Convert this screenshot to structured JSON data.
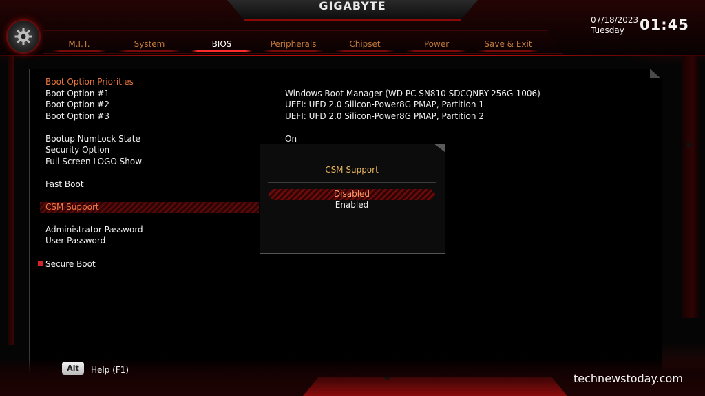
{
  "header": {
    "brand": "GIGABYTE",
    "date": "07/18/2023",
    "day": "Tuesday",
    "time": "01:45"
  },
  "tabs": [
    {
      "label": "M.I.T.",
      "active": false
    },
    {
      "label": "System",
      "active": false
    },
    {
      "label": "BIOS",
      "active": true
    },
    {
      "label": "Peripherals",
      "active": false
    },
    {
      "label": "Chipset",
      "active": false
    },
    {
      "label": "Power",
      "active": false
    },
    {
      "label": "Save & Exit",
      "active": false
    }
  ],
  "bios": {
    "section_heading": "Boot Option Priorities",
    "items": [
      {
        "label": "Boot Option #1",
        "value": "Windows Boot Manager (WD PC SN810 SDCQNRY-256G-1006)"
      },
      {
        "label": "Boot Option #2",
        "value": "UEFI: UFD 2.0 Silicon-Power8G PMAP, Partition 1"
      },
      {
        "label": "Boot Option #3",
        "value": "UEFI: UFD 2.0 Silicon-Power8G PMAP, Partition 2"
      },
      {
        "label": "Bootup NumLock State",
        "value": "On"
      },
      {
        "label": "Security Option",
        "value": ""
      },
      {
        "label": "Full Screen LOGO Show",
        "value": ""
      },
      {
        "label": "Fast Boot",
        "value": ""
      },
      {
        "label": "CSM Support",
        "value": ""
      },
      {
        "label": "Administrator Password",
        "value": ""
      },
      {
        "label": "User Password",
        "value": ""
      },
      {
        "label": "Secure Boot",
        "value": ""
      }
    ],
    "selected_item": "CSM Support"
  },
  "popup": {
    "title": "CSM Support",
    "options": [
      "Disabled",
      "Enabled"
    ],
    "highlighted": "Disabled"
  },
  "footer": {
    "alt_key": "Alt",
    "help_label": "Help (F1)",
    "watermark": "technewstoday.com"
  },
  "colors": {
    "accent_red": "#d4232a",
    "heading_orange": "#e8743a",
    "popup_title_gold": "#e6b45a"
  }
}
